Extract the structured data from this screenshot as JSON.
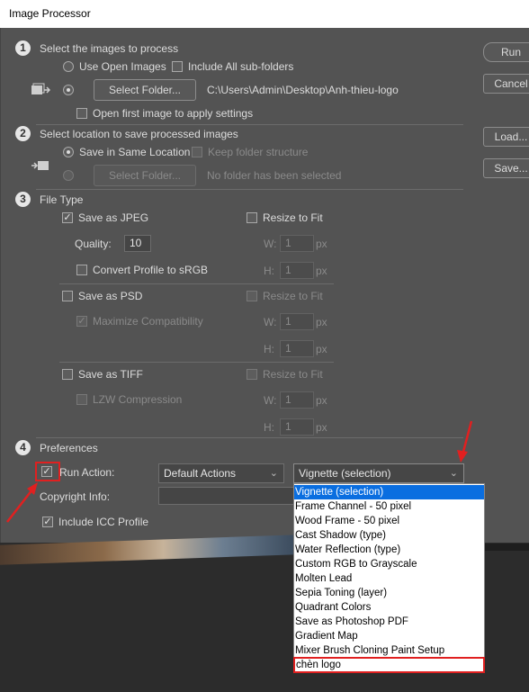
{
  "window": {
    "title": "Image Processor"
  },
  "buttons": {
    "run": "Run",
    "cancel": "Cancel",
    "load": "Load...",
    "save": "Save..."
  },
  "section1": {
    "number": "1",
    "title": "Select the images to process",
    "use_open_images": "Use Open Images",
    "include_subfolders": "Include All sub-folders",
    "select_folder": "Select Folder...",
    "folder_path": "C:\\Users\\Admin\\Desktop\\Anh-thieu-logo",
    "open_first_image": "Open first image to apply settings"
  },
  "section2": {
    "number": "2",
    "title": "Select location to save processed images",
    "save_same_location": "Save in Same Location",
    "keep_folder_structure": "Keep folder structure",
    "select_folder": "Select Folder...",
    "no_folder": "No folder has been selected"
  },
  "section3": {
    "number": "3",
    "title": "File Type",
    "jpeg": {
      "save_as": "Save as JPEG",
      "checked": true,
      "resize": "Resize to Fit",
      "quality_label": "Quality:",
      "quality_value": "10",
      "convert_profile": "Convert Profile to sRGB",
      "w_label": "W:",
      "w_value": "1",
      "h_label": "H:",
      "h_value": "1",
      "unit": "px"
    },
    "psd": {
      "save_as": "Save as PSD",
      "resize": "Resize to Fit",
      "maximize": "Maximize Compatibility",
      "w_label": "W:",
      "w_value": "1",
      "h_label": "H:",
      "h_value": "1",
      "unit": "px"
    },
    "tiff": {
      "save_as": "Save as TIFF",
      "resize": "Resize to Fit",
      "lzw": "LZW Compression",
      "w_label": "W:",
      "w_value": "1",
      "h_label": "H:",
      "h_value": "1",
      "unit": "px"
    }
  },
  "section4": {
    "number": "4",
    "title": "Preferences",
    "run_action": "Run Action:",
    "action_set": "Default Actions",
    "action": "Vignette (selection)",
    "copyright_info": "Copyright Info:",
    "include_icc": "Include ICC Profile"
  },
  "dropdown": {
    "items": [
      "Vignette (selection)",
      "Frame Channel - 50 pixel",
      "Wood Frame - 50 pixel",
      "Cast Shadow (type)",
      "Water Reflection (type)",
      "Custom RGB to Grayscale",
      "Molten Lead",
      "Sepia Toning (layer)",
      "Quadrant Colors",
      "Save as Photoshop PDF",
      "Gradient Map",
      "Mixer Brush Cloning Paint Setup",
      "chèn logo"
    ],
    "selected_index": 0,
    "highlighted_index": 12
  },
  "colors": {
    "dialog_bg": "#535353",
    "selection": "#0a6ee0",
    "annotation_red": "#e02020"
  },
  "icons": {
    "checkmark": "checkmark-icon",
    "chevron": "chevron-down-icon",
    "arrow": "arrow-annotation-icon"
  }
}
